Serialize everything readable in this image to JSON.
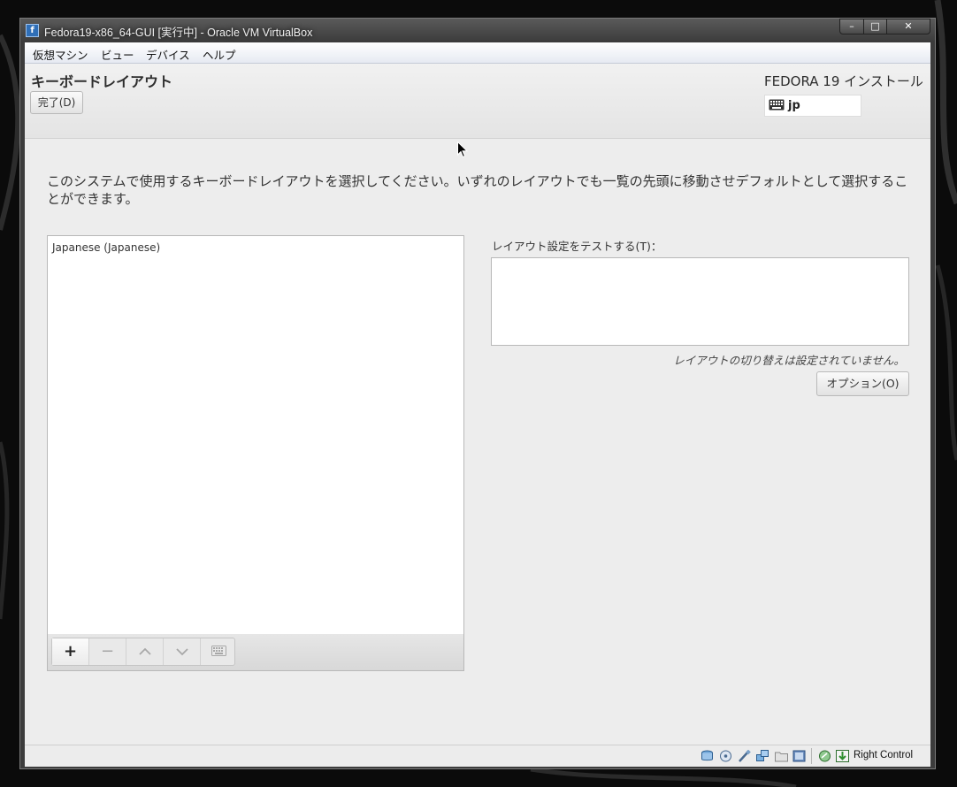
{
  "window": {
    "title": "Fedora19-x86_64-GUI [実行中] - Oracle VM VirtualBox",
    "controls": {
      "minimize": "–",
      "maximize": "□",
      "close": "✕"
    }
  },
  "menubar": {
    "items": [
      {
        "label": "仮想マシン"
      },
      {
        "label": "ビュー"
      },
      {
        "label": "デバイス"
      },
      {
        "label": "ヘルプ"
      }
    ]
  },
  "installer": {
    "page_title": "キーボードレイアウト",
    "done_button": "完了(D)",
    "product_title": "FEDORA 19 インストール",
    "keyboard_indicator": "jp",
    "instructions": "このシステムで使用するキーボードレイアウトを選択してください。いずれのレイアウトでも一覧の先頭に移動させデフォルトとして選択することができます。",
    "layouts": [
      {
        "label": "Japanese (Japanese)"
      }
    ],
    "toolbar": {
      "add": "+",
      "remove": "−"
    },
    "test_label": "レイアウト設定をテストする(T)：",
    "test_value": "",
    "no_switch_text": "レイアウトの切り替えは設定されていません。",
    "options_button": "オプション(O)"
  },
  "statusbar": {
    "host_key": "Right Control",
    "icons": [
      "hard-disk-icon",
      "optical-drive-icon",
      "usb-icon",
      "network-icon",
      "shared-folder-icon",
      "display-icon",
      "mouse-integration-icon",
      "keyboard-capture-icon"
    ]
  }
}
